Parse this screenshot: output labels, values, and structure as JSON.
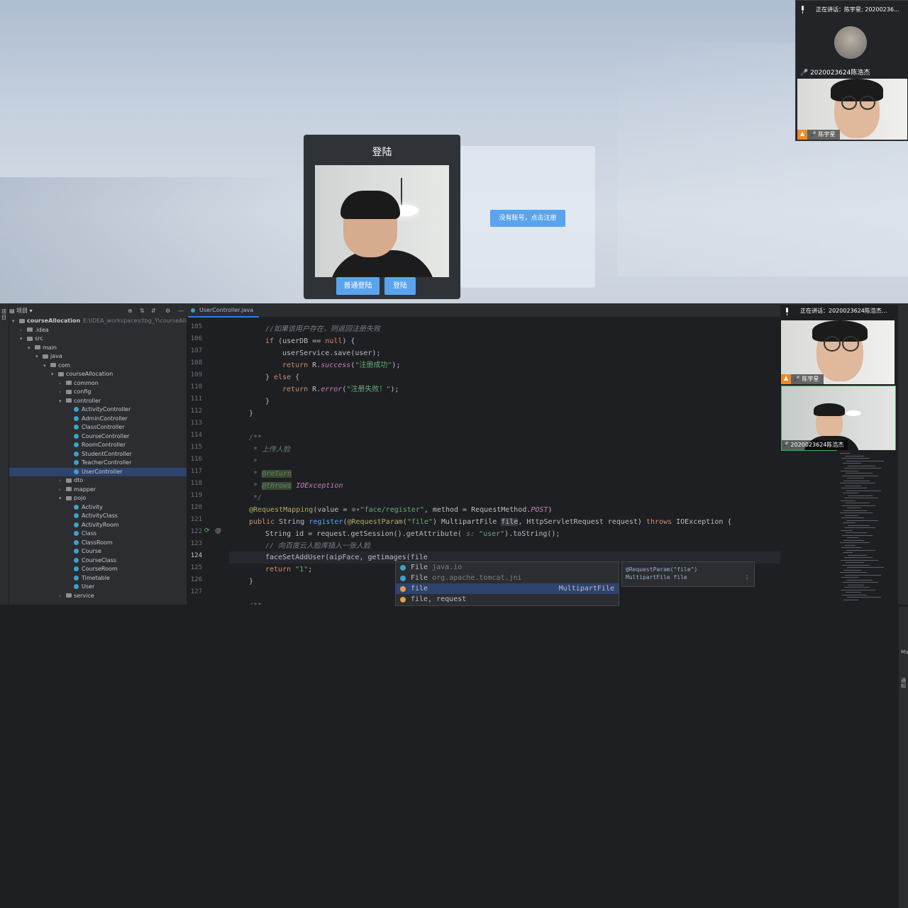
{
  "login_app": {
    "title": "登陆",
    "normal_login_button": "普通登陆",
    "login_button": "登陆",
    "register_button": "没有账号，点击注册"
  },
  "meeting_top": {
    "speaking": "正在讲话：陈宇星; 20200236...",
    "participant_1": "2020023624陈浩杰",
    "participant_2": "陈宇星"
  },
  "meeting_bottom": {
    "speaking": "正在讲话：2020023624陈浩杰...",
    "participant_1": "陈宇星",
    "participant_2": "2020023624陈浩杰"
  },
  "ide": {
    "left_stripe_label": "项目",
    "project_panel_title": "项目",
    "open_tab": "UserController.java",
    "right_stripe_labels": [
      "Maven",
      "通知"
    ],
    "tree": [
      {
        "label": "courseAllocation",
        "suffix": "E:\\IDEA_workspace\\ctbg_Y\\courseAllocation",
        "indent": 0,
        "kind": "folder",
        "open": true
      },
      {
        "label": ".idea",
        "indent": 1,
        "kind": "folder",
        "open": false
      },
      {
        "label": "src",
        "indent": 1,
        "kind": "folder",
        "open": true
      },
      {
        "label": "main",
        "indent": 2,
        "kind": "folder",
        "open": true
      },
      {
        "label": "java",
        "indent": 3,
        "kind": "folder",
        "open": true
      },
      {
        "label": "com",
        "indent": 4,
        "kind": "folder",
        "open": true
      },
      {
        "label": "courseAllocation",
        "indent": 5,
        "kind": "folder",
        "open": true
      },
      {
        "label": "common",
        "indent": 6,
        "kind": "folder",
        "open": false
      },
      {
        "label": "config",
        "indent": 6,
        "kind": "folder",
        "open": false
      },
      {
        "label": "controller",
        "indent": 6,
        "kind": "folder",
        "open": true
      },
      {
        "label": "ActivityController",
        "indent": 7,
        "kind": "class"
      },
      {
        "label": "AdminController",
        "indent": 7,
        "kind": "class"
      },
      {
        "label": "ClassController",
        "indent": 7,
        "kind": "class"
      },
      {
        "label": "CourseController",
        "indent": 7,
        "kind": "class"
      },
      {
        "label": "RoomController",
        "indent": 7,
        "kind": "class"
      },
      {
        "label": "StudentController",
        "indent": 7,
        "kind": "class"
      },
      {
        "label": "TeacherController",
        "indent": 7,
        "kind": "class"
      },
      {
        "label": "UserController",
        "indent": 7,
        "kind": "class",
        "selected": true
      },
      {
        "label": "dto",
        "indent": 6,
        "kind": "folder",
        "open": false
      },
      {
        "label": "mapper",
        "indent": 6,
        "kind": "folder",
        "open": false
      },
      {
        "label": "pojo",
        "indent": 6,
        "kind": "folder",
        "open": true
      },
      {
        "label": "Activity",
        "indent": 7,
        "kind": "class"
      },
      {
        "label": "ActivityClass",
        "indent": 7,
        "kind": "class"
      },
      {
        "label": "ActivityRoom",
        "indent": 7,
        "kind": "class"
      },
      {
        "label": "Class",
        "indent": 7,
        "kind": "class"
      },
      {
        "label": "ClassRoom",
        "indent": 7,
        "kind": "class"
      },
      {
        "label": "Course",
        "indent": 7,
        "kind": "class"
      },
      {
        "label": "CourseClass",
        "indent": 7,
        "kind": "class"
      },
      {
        "label": "CourseRoom",
        "indent": 7,
        "kind": "class"
      },
      {
        "label": "Timetable",
        "indent": 7,
        "kind": "class"
      },
      {
        "label": "User",
        "indent": 7,
        "kind": "class"
      },
      {
        "label": "service",
        "indent": 6,
        "kind": "folder",
        "open": false
      }
    ],
    "line_numbers": [
      "105",
      "106",
      "107",
      "108",
      "109",
      "110",
      "111",
      "112",
      "113",
      "114",
      "115",
      "116",
      "117",
      "118",
      "119",
      "120",
      "121",
      "122",
      "123",
      "124",
      "125",
      "126",
      "127"
    ],
    "current_line": "124",
    "completion": [
      {
        "name": "File",
        "detail": "java.io",
        "type": ""
      },
      {
        "name": "File",
        "detail": "org.apache.tomcat.jni",
        "type": ""
      },
      {
        "name": "file",
        "detail": "",
        "type": "MultipartFile",
        "selected": true
      },
      {
        "name": "file, request",
        "detail": "",
        "type": ""
      }
    ],
    "param_hint_1": "@RequestParam(\"file\")",
    "param_hint_2": "MultipartFile file"
  }
}
